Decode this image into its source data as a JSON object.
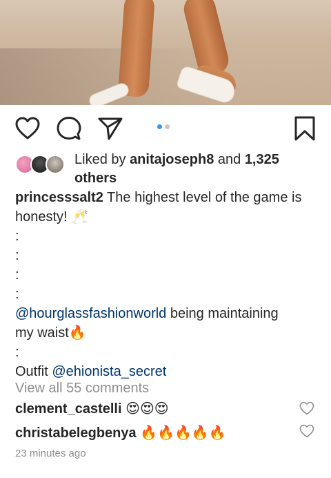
{
  "post": {
    "likes": {
      "prefix": "Liked by ",
      "user": "anitajoseph8",
      "middle": " and ",
      "count": "1,325",
      "suffix": "others"
    },
    "caption": {
      "username": "princesssalt2",
      "line1_text": " The highest level of the game is",
      "line2_text": "honesty! 🥂",
      "dot": ":",
      "mention1": "@hourglassfashionworld",
      "mention1_after": " being maintaining",
      "line_waist": "my waist🔥",
      "outfit_prefix": "Outfit ",
      "mention2": "@ehionista_secret"
    },
    "view_all": "View all 55 comments",
    "comments": [
      {
        "user": "clement_castelli",
        "text": " 😍😍😍"
      },
      {
        "user": "christabelegbenya",
        "text": " 🔥🔥🔥🔥🔥"
      }
    ],
    "time": "23 minutes ago"
  },
  "icons": {
    "like": "heart-icon",
    "comment": "comment-icon",
    "share": "paper-plane-icon",
    "save": "bookmark-icon"
  },
  "colors": {
    "text": "#262626",
    "muted": "#8e8e8e",
    "mention": "#003569",
    "active_dot": "#3897f0"
  }
}
